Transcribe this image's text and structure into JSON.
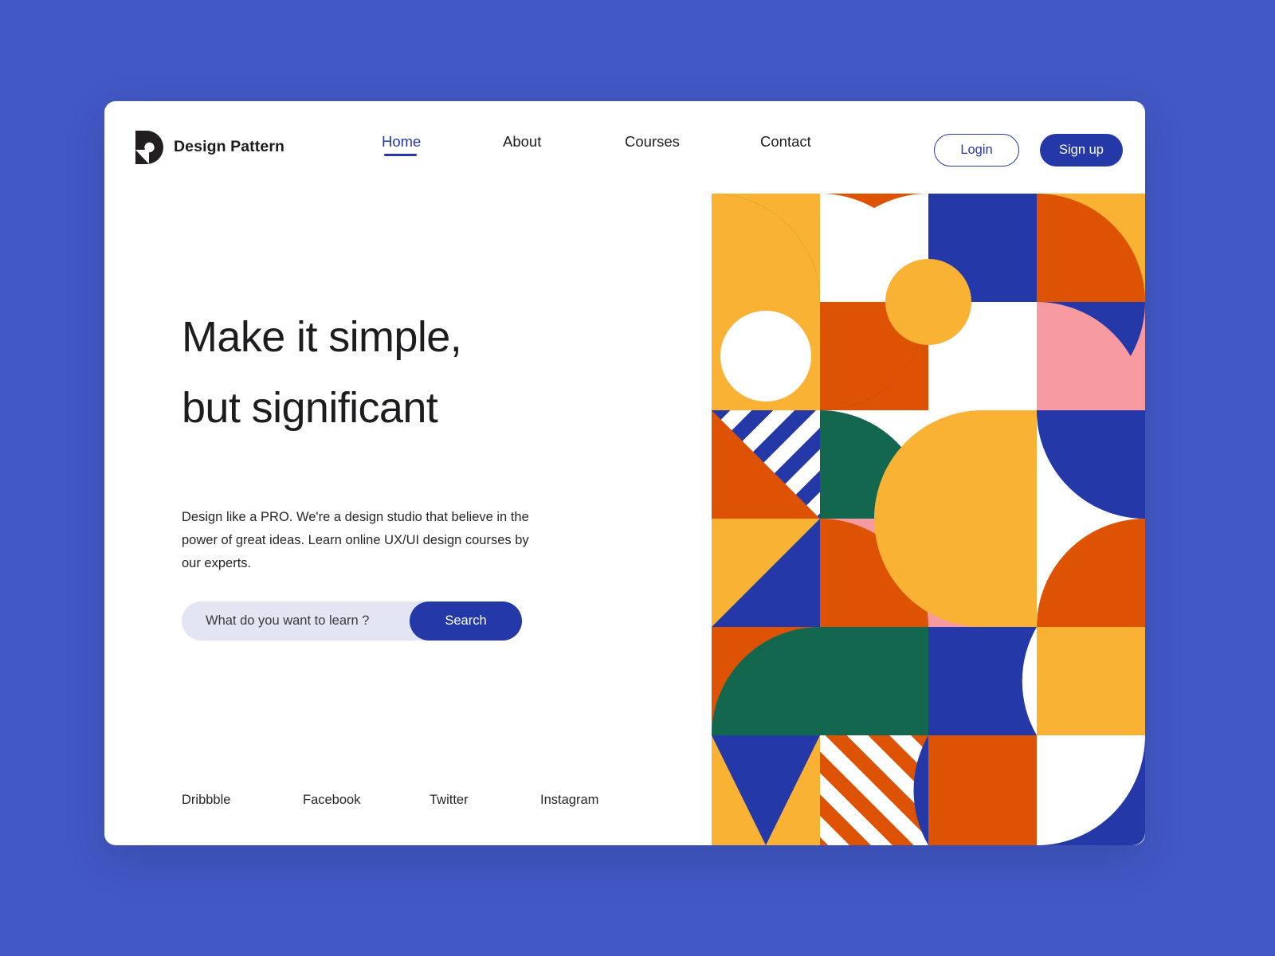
{
  "theme": {
    "page_background": "#4258c4",
    "card_background": "#ffffff",
    "accent_blue": "#2438a8",
    "text_dark": "#1d1d1f",
    "search_field_bg": "#e3e6f2",
    "pattern_yellow": "#f9b233",
    "pattern_orange": "#de5204",
    "pattern_blue": "#2438a8",
    "pattern_green": "#13674f",
    "pattern_pink": "#f79ba0",
    "pattern_white": "#ffffff"
  },
  "header": {
    "logo_icon": "design-pattern-d-logo",
    "brand_name": "Design Pattern",
    "nav": [
      {
        "label": "Home",
        "active": true
      },
      {
        "label": "About",
        "active": false
      },
      {
        "label": "Courses",
        "active": false
      },
      {
        "label": "Contact",
        "active": false
      }
    ],
    "login_label": "Login",
    "signup_label": "Sign up"
  },
  "hero": {
    "headline_line1": "Make it simple,",
    "headline_line2": "but significant",
    "paragraph": "Design like a PRO. We're a design studio that believe in the power of great ideas. Learn online UX/UI design courses by our experts.",
    "search": {
      "placeholder": "What do you want to learn ?",
      "value": "",
      "button_label": "Search"
    }
  },
  "footer": {
    "social_links": [
      {
        "label": "Dribbble"
      },
      {
        "label": "Facebook"
      },
      {
        "label": "Twitter"
      },
      {
        "label": "Instagram"
      }
    ]
  },
  "decor": {
    "pattern_name": "geometric-bauhaus-pattern",
    "grid_columns": 4,
    "grid_rows": 6,
    "cell_size": 136
  }
}
